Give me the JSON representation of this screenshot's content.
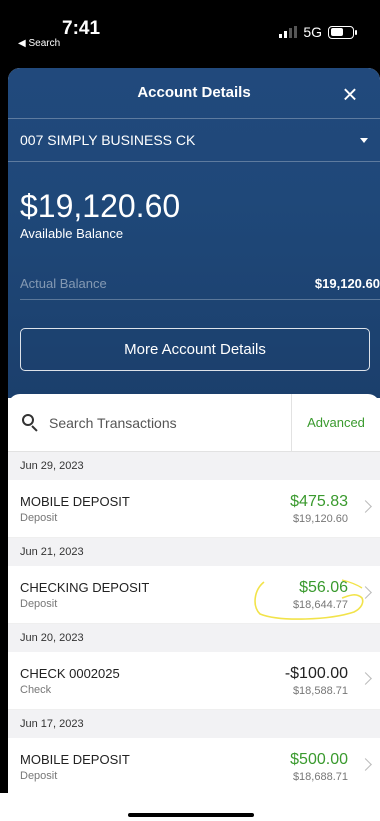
{
  "status_bar": {
    "time": "7:41",
    "back_label": "◀ Search",
    "network": "5G"
  },
  "header": {
    "title": "Account Details",
    "close_icon": "×",
    "account_name": "007 SIMPLY BUSINESS CK",
    "available_balance": "$19,120.60",
    "available_label": "Available Balance",
    "actual_label": "Actual Balance",
    "actual_value": "$19,120.60",
    "more_button": "More Account Details"
  },
  "search": {
    "placeholder": "Search Transactions",
    "advanced_label": "Advanced"
  },
  "groups": [
    {
      "date": "Jun 29, 2023",
      "txn": {
        "name": "MOBILE DEPOSIT",
        "type": "Deposit",
        "amount": "$475.83",
        "balance": "$19,120.60"
      }
    },
    {
      "date": "Jun 21, 2023",
      "txn": {
        "name": "CHECKING DEPOSIT",
        "type": "Deposit",
        "amount": "$56.06",
        "balance": "$18,644.77"
      }
    },
    {
      "date": "Jun 20, 2023",
      "txn": {
        "name": "CHECK 0002025",
        "type": "Check",
        "amount": "-$100.00",
        "balance": "$18,588.71"
      }
    },
    {
      "date": "Jun 17, 2023",
      "txn": {
        "name": "MOBILE DEPOSIT",
        "type": "Deposit",
        "amount": "$500.00",
        "balance": "$18,688.71"
      }
    }
  ],
  "colors": {
    "header_blue": "#1f4879",
    "positive_green": "#3a9a2e",
    "highlight_yellow": "#f2e34a"
  }
}
